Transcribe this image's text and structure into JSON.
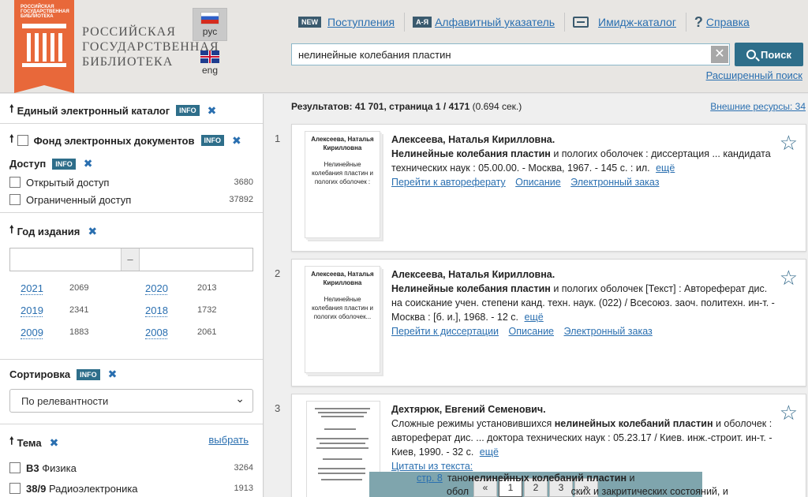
{
  "header": {
    "logo_badge_text": "РОССИЙСКАЯ ГОСУДАРСТВЕННАЯ БИБЛИОТЕКА",
    "logo_text": [
      "РОССИЙСКАЯ",
      "ГОСУДАРСТВЕННАЯ",
      "БИБЛИОТЕКА"
    ],
    "lang_ru": "рус",
    "lang_en": "eng",
    "nav": {
      "new_badge": "NEW",
      "arrivals": "Поступления",
      "az_badge": "А-Я",
      "alphabet_index": "Алфавитный указатель",
      "image_catalog": "Имидж-каталог",
      "help_glyph": "?",
      "help": "Справка"
    },
    "search": {
      "value": "нелинейные колебания пластин",
      "clear_glyph": "✕",
      "button": "Поиск",
      "advanced": "Расширенный поиск"
    }
  },
  "sidebar": {
    "info_label": "INFO",
    "x_glyph": "✖",
    "up_glyph": "🠕",
    "unified_catalog": "Единый электронный каталог",
    "edoc_fund": "Фонд электронных документов",
    "access": {
      "title": "Доступ",
      "items": [
        {
          "label": "Открытый доступ",
          "count": "3680"
        },
        {
          "label": "Ограниченный доступ",
          "count": "37892"
        }
      ]
    },
    "year": {
      "title": "Год издания",
      "dash": "–",
      "items": [
        {
          "year": "2021",
          "count": "2069"
        },
        {
          "year": "2020",
          "count": "2013"
        },
        {
          "year": "2019",
          "count": "2341"
        },
        {
          "year": "2018",
          "count": "1732"
        },
        {
          "year": "2009",
          "count": "1883"
        },
        {
          "year": "2008",
          "count": "2061"
        }
      ]
    },
    "sort": {
      "title": "Сортировка",
      "selected": "По релевантности",
      "caret": "⌄"
    },
    "theme": {
      "title": "Тема",
      "choose": "выбрать",
      "items": [
        {
          "code": "В3",
          "label": "Физика",
          "count": "3264"
        },
        {
          "code": "38/9",
          "label": "Радиоэлектроника",
          "count": "1913"
        }
      ]
    }
  },
  "results": {
    "summary_prefix": "Результатов: 41 701, страница 1 / 4171",
    "summary_time": "(0.694 сек.)",
    "external": "Внешние ресурсы: 34",
    "more": "ещё",
    "items": [
      {
        "num": "1",
        "thumb_author": "Алексеева, Наталья Кирилловна",
        "thumb_title": "Нелинейные колебания пластин и пологих оболочек :",
        "author": "Алексеева, Наталья Кирилловна.",
        "title_bold": "Нелинейные колебания пластин",
        "rest": " и пологих оболочек : диссертация ... кандидата технических наук : 05.00.00. - Москва, 1967. - 145 с. : ил.",
        "links": [
          "Перейти к автореферату",
          "Описание",
          "Электронный заказ"
        ]
      },
      {
        "num": "2",
        "thumb_author": "Алексеева, Наталья Кирилловна",
        "thumb_title": "Нелинейные колебания пластин и пологих оболочек...",
        "author": "Алексеева, Наталья Кирилловна.",
        "title_bold": "Нелинейные колебания пластин",
        "rest": " и пологих оболочек [Текст] : Автореферат дис. на соискание учен. степени канд. техн. наук. (022) / Всесоюз. заоч. политехн. ин-т. - Москва : [б. и.], 1968. - 12 с.",
        "links": [
          "Перейти к диссертации",
          "Описание",
          "Электронный заказ"
        ]
      },
      {
        "num": "3",
        "author": "Дехтярюк, Евгений Семенович.",
        "pre": "Сложные режимы установившихся ",
        "title_bold": "нелинейных колебаний пластин",
        "rest": " и оболочек : автореферат дис. ... доктора технических наук : 05.23.17 / Киев. инж.-строит. ин-т. - Киев, 1990. - 32 с.",
        "citations": "Цитаты из текста:",
        "cite_page": "стр. 8",
        "cite_line1_pre": "тано",
        "cite_line1_bold": "нелинейных колебаний пластин",
        "cite_line1_post": " и",
        "cite_line2_pre": "обол",
        "cite_line2_post": "ских и закритических состояний, и"
      }
    ]
  },
  "pager": {
    "prev": "«",
    "pages": [
      "1",
      "2",
      "3"
    ],
    "next": "»"
  }
}
